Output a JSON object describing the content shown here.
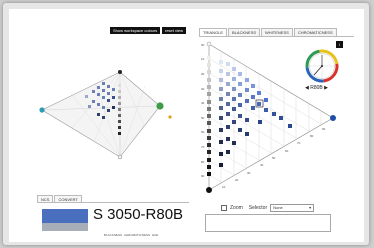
{
  "toolbar": {
    "show_workspace_colours": "Show workspace colours",
    "reset_view": "reset view"
  },
  "tabs": [
    "TRIANGLE",
    "BLACKNESS",
    "WHITENESS",
    "CHROMATICNESS"
  ],
  "triangle": {
    "left_axis_ticks": [
      "00",
      "10",
      "20",
      "30",
      "40",
      "50",
      "60",
      "70",
      "80",
      "90"
    ],
    "diag_ticks": [
      "10",
      "20",
      "30",
      "40",
      "50",
      "60",
      "70",
      "80",
      "90"
    ]
  },
  "hue_wheel": {
    "hue_label": "R80B",
    "prev_arrow": "◀",
    "next_arrow": "▶",
    "corner_button": "i"
  },
  "ncs_tabs": [
    "NCS",
    "CONVERT"
  ],
  "ncs": {
    "code": "S 3050-R80B",
    "sublabels": "BLACKNESS CHROMATICNESS HUE",
    "swatch_color": "#4a6fbf"
  },
  "zoom": {
    "zoom_label": "Zoom",
    "selector_label": "Selector",
    "selector_value": "None"
  }
}
